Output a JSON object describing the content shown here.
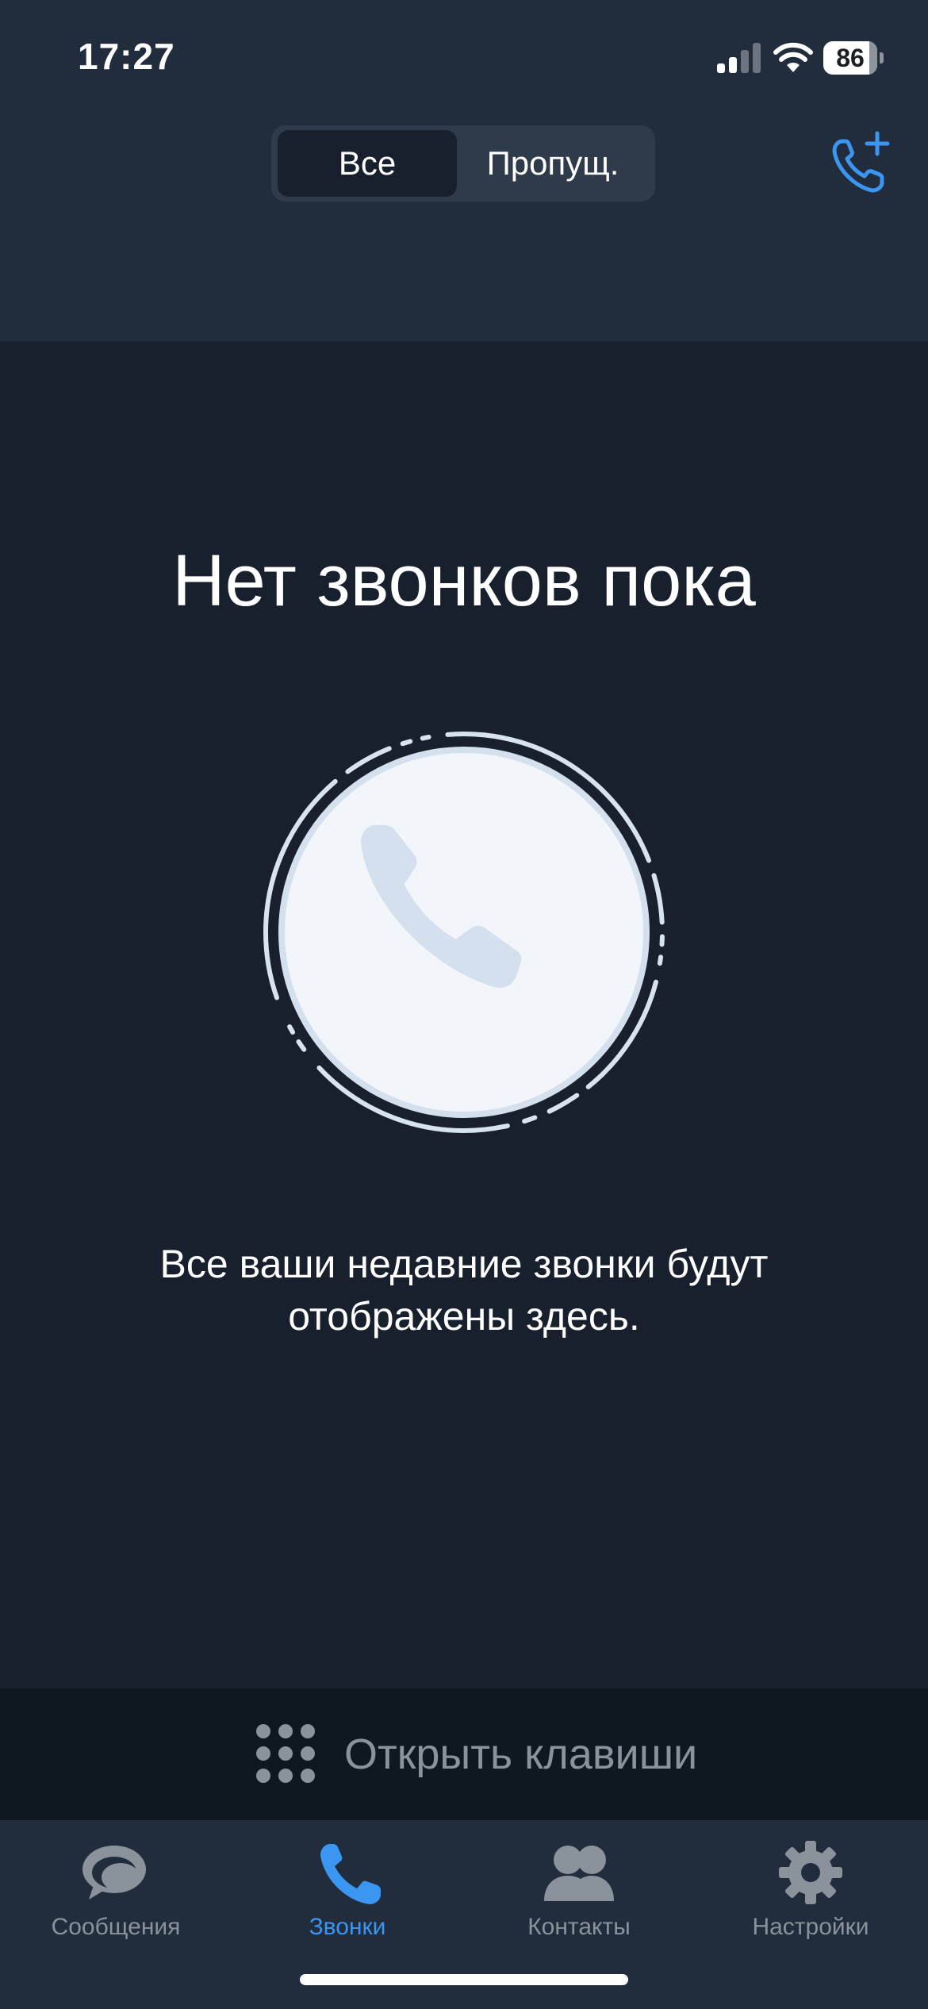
{
  "status_bar": {
    "time": "17:27",
    "battery_level": "86",
    "icons": [
      "signal-icon",
      "wifi-icon",
      "battery-icon"
    ]
  },
  "header": {
    "segments": [
      {
        "label": "Все",
        "selected": true
      },
      {
        "label": "Пропущ.",
        "selected": false
      }
    ],
    "add_call_icon": "phone-plus-icon"
  },
  "empty_state": {
    "title": "Нет звонков пока",
    "illustration_icon": "phone-icon",
    "description": "Все ваши недавние звонки будут отображены здесь."
  },
  "keypad": {
    "label": "Открыть клавиши",
    "icon": "dialpad-icon"
  },
  "tabbar": {
    "tabs": [
      {
        "label": "Сообщения",
        "icon": "chat-bubbles-icon",
        "active": false
      },
      {
        "label": "Звонки",
        "icon": "phone-icon",
        "active": true
      },
      {
        "label": "Контакты",
        "icon": "contacts-icon",
        "active": false
      },
      {
        "label": "Настройки",
        "icon": "gear-icon",
        "active": false
      }
    ]
  },
  "colors": {
    "accent": "#3a96f0",
    "header_bg": "#212d3c",
    "content_bg": "#17202c",
    "keypad_bg": "#0f1821",
    "muted_text": "#8a939c"
  }
}
